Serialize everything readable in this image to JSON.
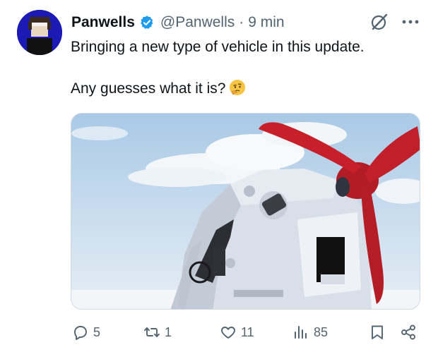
{
  "post": {
    "author": {
      "display_name": "Panwells",
      "handle": "@Panwells",
      "verified": true
    },
    "separator": "·",
    "time": "9 min",
    "text_line1": "Bringing a new type of vehicle in this update.",
    "text_line2": "Any guesses what it is?",
    "emoji": "thinking-face-icon",
    "media": {
      "description_icon": "image"
    },
    "actions": {
      "replies": "5",
      "reposts": "1",
      "likes": "11",
      "views": "85"
    }
  },
  "colors": {
    "verified": "#1d9bf0",
    "muted": "#536471",
    "text": "#0f1419",
    "propeller": "#c8202a"
  }
}
